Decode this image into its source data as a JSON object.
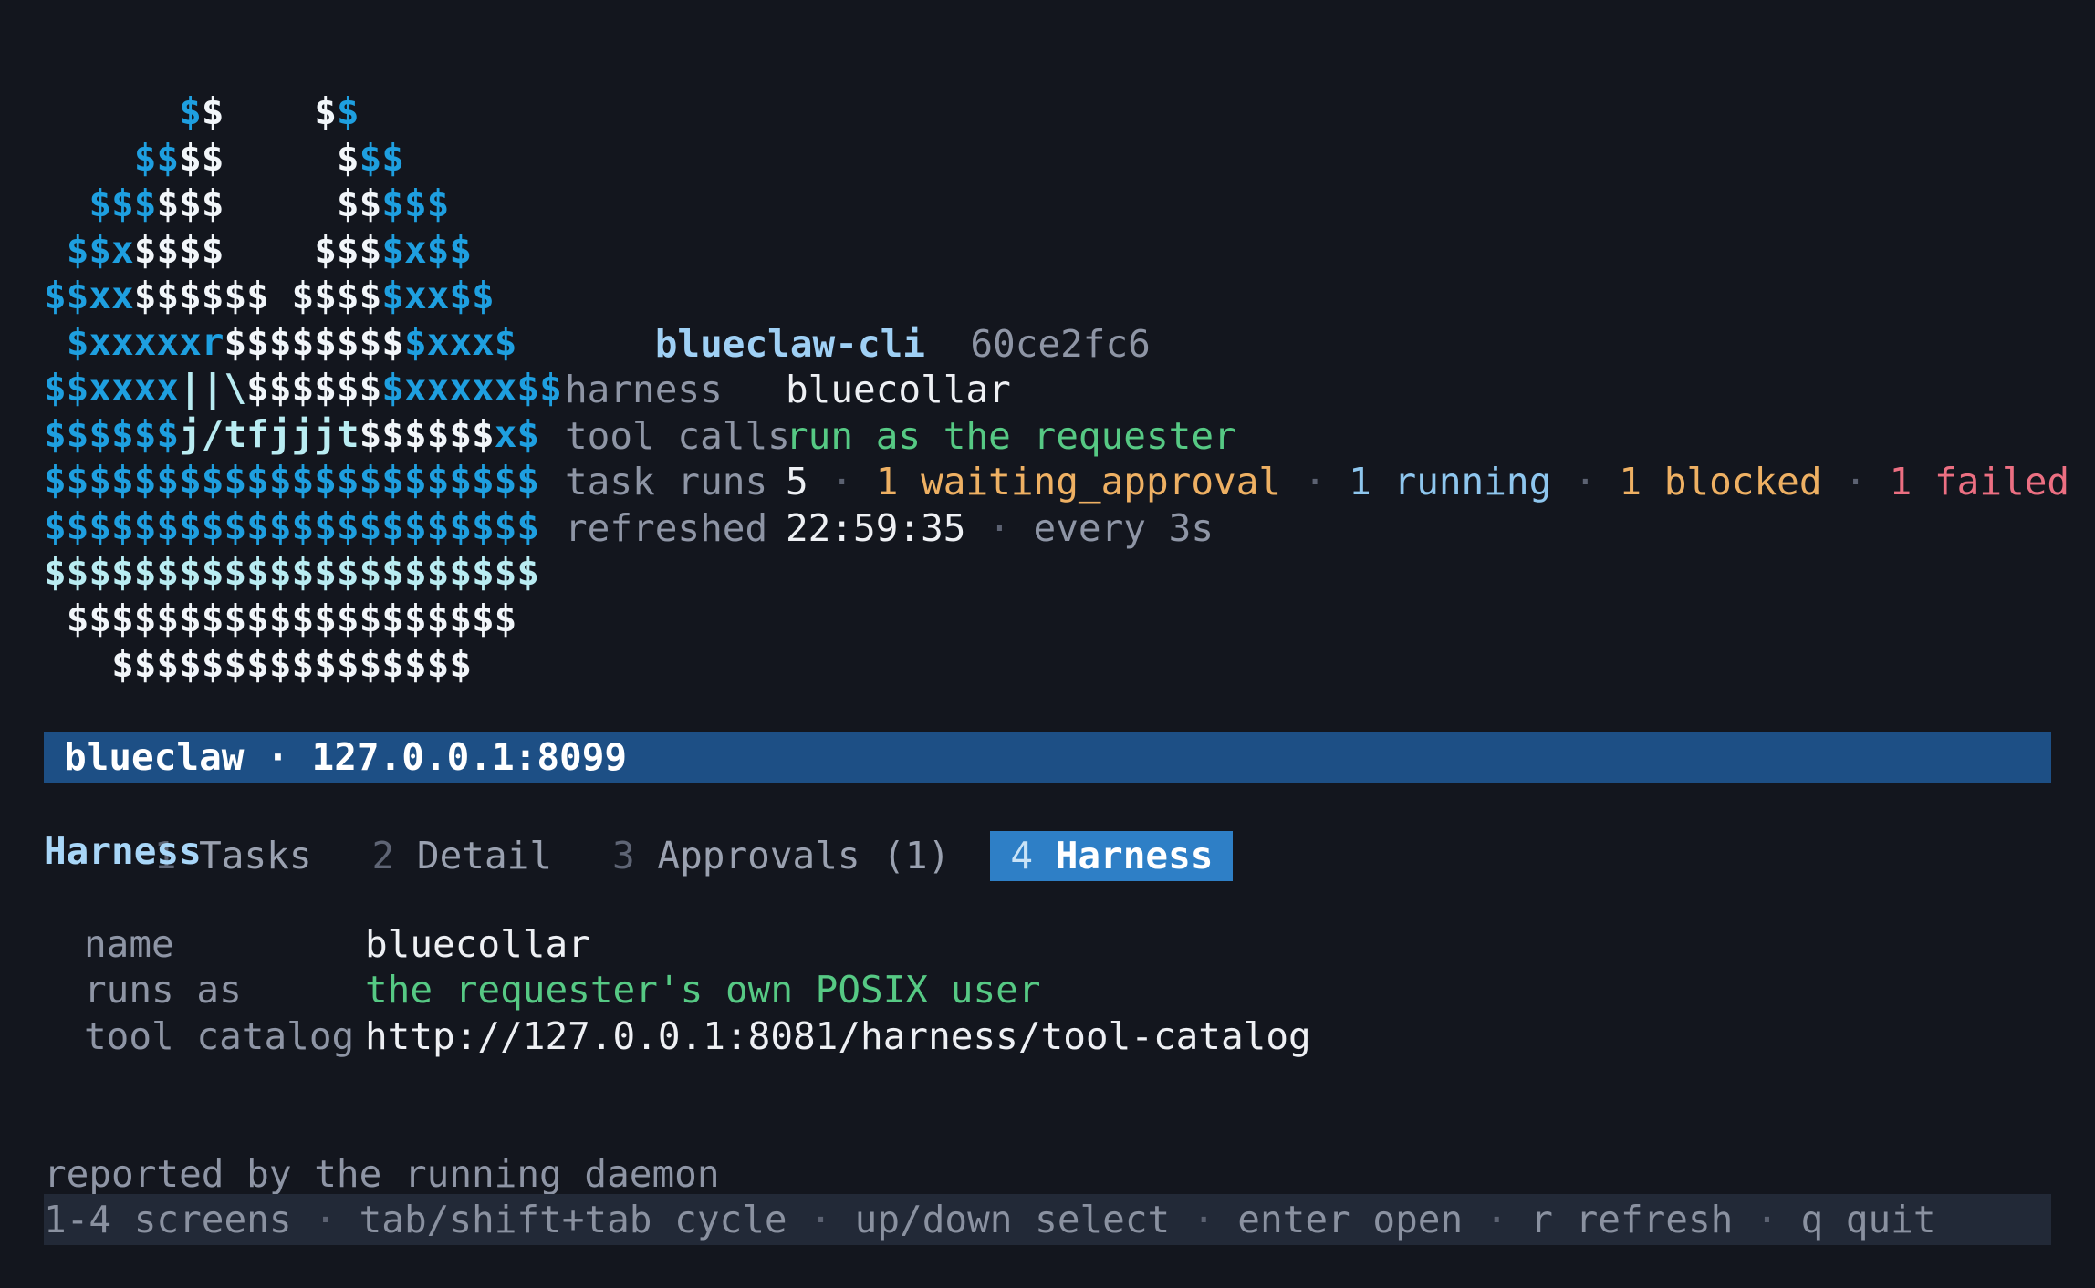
{
  "logo": {
    "lines": [
      [
        [
          "      ",
          "lw"
        ],
        [
          "$",
          "lb"
        ],
        [
          "$",
          "lw"
        ],
        [
          "    ",
          "lw"
        ],
        [
          "$",
          "lw"
        ],
        [
          "$",
          "lb"
        ]
      ],
      [
        [
          "    ",
          "lw"
        ],
        [
          "$$",
          "lb"
        ],
        [
          "$$",
          "lw"
        ],
        [
          "     ",
          "lw"
        ],
        [
          "$",
          "lw"
        ],
        [
          "$$",
          "lb"
        ]
      ],
      [
        [
          "  ",
          "lw"
        ],
        [
          "$$$",
          "lb"
        ],
        [
          "$$$",
          "lw"
        ],
        [
          "     ",
          "lw"
        ],
        [
          "$$",
          "lw"
        ],
        [
          "$$$",
          "lb"
        ]
      ],
      [
        [
          " ",
          "lw"
        ],
        [
          "$$x",
          "lb"
        ],
        [
          "$$$$",
          "lw"
        ],
        [
          "    ",
          "lw"
        ],
        [
          "$$$",
          "lw"
        ],
        [
          "$x$$",
          "lb"
        ]
      ],
      [
        [
          "",
          "lw"
        ],
        [
          "$$xx",
          "lb"
        ],
        [
          "$$$$$$",
          "lw"
        ],
        [
          " ",
          "lw"
        ],
        [
          "$$$$",
          "lw"
        ],
        [
          "$xx$$",
          "lb"
        ]
      ],
      [
        [
          " ",
          "lw"
        ],
        [
          "$xxxxxr",
          "lb"
        ],
        [
          "$$$$$$$$",
          "lw"
        ],
        [
          "$xxx$",
          "lb"
        ]
      ],
      [
        [
          "",
          "lw"
        ],
        [
          "$$xxxx",
          "lb"
        ],
        [
          "||\\",
          "lc"
        ],
        [
          "$$$$$$",
          "lw"
        ],
        [
          "$xxxxx$$",
          "lb"
        ]
      ],
      [
        [
          "",
          "lw"
        ],
        [
          "$$$$$$",
          "lb"
        ],
        [
          "j/tfjjjt",
          "lc"
        ],
        [
          "$$$$$$",
          "lw"
        ],
        [
          "x$",
          "lb"
        ]
      ],
      [
        [
          "",
          "lw"
        ],
        [
          "$$$$$$$$$$$$$$$$$$$$$$",
          "lb"
        ]
      ],
      [
        [
          "",
          "lw"
        ],
        [
          "$$$$$$$$$$$$$$$$$$$$$$",
          "lb"
        ]
      ],
      [
        [
          "",
          "lw"
        ],
        [
          "$$$$$$$$$$$$$$$$$$$$$$",
          "lc"
        ]
      ],
      [
        [
          " ",
          "lw"
        ],
        [
          "$$$$$$$$$$$$$$$$$$$$",
          "lw"
        ]
      ],
      [
        [
          "   ",
          "lw"
        ],
        [
          "$$$$$$$$$$$$$$$$",
          "lw"
        ]
      ]
    ]
  },
  "header": {
    "app_name": "blueclaw-cli",
    "version": "60ce2fc6",
    "harness_label": "harness",
    "harness_value": "bluecollar",
    "tool_calls_label": "tool calls",
    "tool_calls_value": "run as the requester",
    "task_runs_label": "task runs",
    "task_runs_total": "5",
    "task_runs_waiting": "1 waiting_approval",
    "task_runs_running": "1 running",
    "task_runs_blocked": "1 blocked",
    "task_runs_failed": "1 failed",
    "refreshed_label": "refreshed",
    "refreshed_time": "22:59:35",
    "refresh_interval": "every 3s",
    "separator": "·"
  },
  "statusbar": {
    "text": "blueclaw · 127.0.0.1:8099"
  },
  "tabs": [
    {
      "num": "1",
      "label": "Tasks",
      "active": false
    },
    {
      "num": "2",
      "label": "Detail",
      "active": false
    },
    {
      "num": "3",
      "label": "Approvals (1)",
      "active": false
    },
    {
      "num": "4",
      "label": "Harness",
      "active": true
    }
  ],
  "harness": {
    "title": "Harness",
    "name_label": "name",
    "name_value": "bluecollar",
    "runs_as_label": "runs as",
    "runs_as_value": "the requester's own POSIX user",
    "tool_catalog_label": "tool catalog",
    "tool_catalog_value": "http://127.0.0.1:8081/harness/tool-catalog"
  },
  "footer": {
    "note": "reported by the running daemon",
    "help": [
      "1-4 screens",
      "tab/shift+tab cycle",
      "up/down select",
      "enter open",
      "r refresh",
      "q quit"
    ]
  },
  "colors": {
    "background": "#13161e",
    "statusbar": "#1d4f85",
    "active_tab": "#2e7fc6",
    "green": "#56c984",
    "orange": "#eeb063",
    "blue": "#8ec6ee",
    "red": "#ec6f82"
  }
}
